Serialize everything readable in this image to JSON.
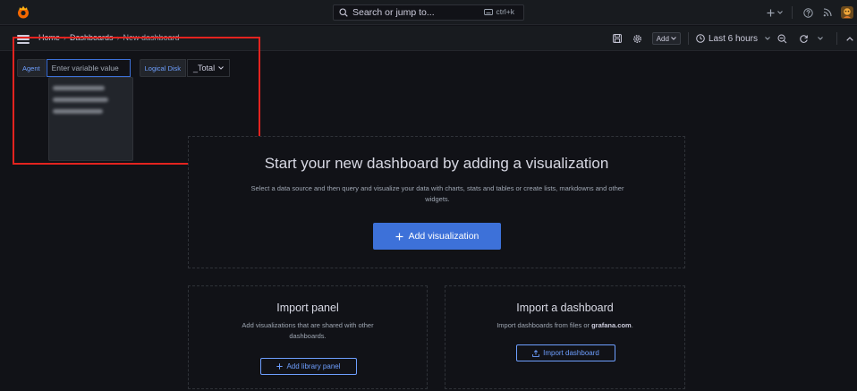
{
  "search": {
    "placeholder": "Search or jump to...",
    "shortcut": "ctrl+k"
  },
  "topbar": {
    "icons": [
      "grafana-logo-icon",
      "plus-icon",
      "chevron-down-icon",
      "help-icon",
      "rss-icon",
      "avatar"
    ]
  },
  "breadcrumb": {
    "items": [
      "Home",
      "Dashboards",
      "New dashboard"
    ]
  },
  "toolbar": {
    "add_label": "Add",
    "time_range": "Last 6 hours"
  },
  "variables": {
    "agent": {
      "label": "Agent",
      "placeholder": "Enter variable value"
    },
    "logical_disk": {
      "label": "Logical Disk",
      "value": "_Total"
    }
  },
  "hero": {
    "title": "Start your new dashboard by adding a visualization",
    "subtitle": "Select a data source and then query and visualize your data with charts, stats and tables or create lists, markdowns and other widgets.",
    "button": "Add visualization"
  },
  "import_panel": {
    "title": "Import panel",
    "subtitle": "Add visualizations that are shared with other dashboards.",
    "button": "Add library panel"
  },
  "import_dashboard": {
    "title": "Import a dashboard",
    "subtitle_prefix": "Import dashboards from files or ",
    "subtitle_link": "grafana.com",
    "subtitle_suffix": ".",
    "button": "Import dashboard"
  },
  "colors": {
    "accent": "#3d71d9",
    "link": "#6e9fff",
    "highlight": "#e3231f",
    "background": "#111217"
  }
}
